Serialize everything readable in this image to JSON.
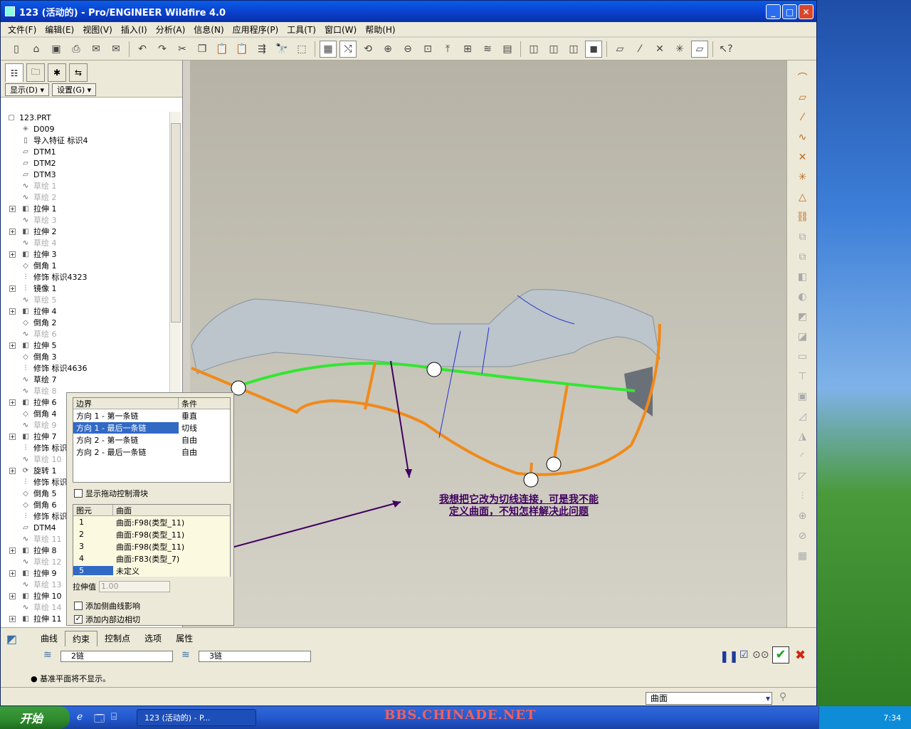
{
  "window": {
    "title": "123 (活动的) - Pro/ENGINEER Wildfire 4.0"
  },
  "menu": [
    "文件(F)",
    "编辑(E)",
    "视图(V)",
    "插入(I)",
    "分析(A)",
    "信息(N)",
    "应用程序(P)",
    "工具(T)",
    "窗口(W)",
    "帮助(H)"
  ],
  "panel": {
    "show_btn": "显示(D) ▾",
    "settings_btn": "设置(G) ▾"
  },
  "tree": [
    {
      "label": "123.PRT",
      "exp": false,
      "grey": false,
      "icon": "part-icon",
      "lvl": 0
    },
    {
      "label": "D009",
      "exp": false,
      "grey": false,
      "icon": "csys-icon",
      "lvl": 1
    },
    {
      "label": "导入特征 标识4",
      "exp": false,
      "grey": false,
      "icon": "import-icon",
      "lvl": 1
    },
    {
      "label": "DTM1",
      "exp": false,
      "grey": false,
      "icon": "datum-plane-icon",
      "lvl": 1
    },
    {
      "label": "DTM2",
      "exp": false,
      "grey": false,
      "icon": "datum-plane-icon",
      "lvl": 1
    },
    {
      "label": "DTM3",
      "exp": false,
      "grey": false,
      "icon": "datum-plane-icon",
      "lvl": 1
    },
    {
      "label": "草绘 1",
      "exp": false,
      "grey": true,
      "icon": "sketch-icon",
      "lvl": 1
    },
    {
      "label": "草绘 2",
      "exp": false,
      "grey": true,
      "icon": "sketch-icon",
      "lvl": 1
    },
    {
      "label": "拉伸 1",
      "exp": true,
      "grey": false,
      "icon": "extrude-icon",
      "lvl": 1
    },
    {
      "label": "草绘 3",
      "exp": false,
      "grey": true,
      "icon": "sketch-icon",
      "lvl": 1
    },
    {
      "label": "拉伸 2",
      "exp": true,
      "grey": false,
      "icon": "extrude-icon",
      "lvl": 1
    },
    {
      "label": "草绘 4",
      "exp": false,
      "grey": true,
      "icon": "sketch-icon",
      "lvl": 1
    },
    {
      "label": "拉伸 3",
      "exp": true,
      "grey": false,
      "icon": "extrude-icon",
      "lvl": 1
    },
    {
      "label": "倒角 1",
      "exp": false,
      "grey": false,
      "icon": "chamfer-icon",
      "lvl": 1
    },
    {
      "label": "修饰 标识4323",
      "exp": false,
      "grey": false,
      "icon": "cosmetic-icon",
      "lvl": 1
    },
    {
      "label": "镜像 1",
      "exp": true,
      "grey": false,
      "icon": "mirror-icon",
      "lvl": 1
    },
    {
      "label": "草绘 5",
      "exp": false,
      "grey": true,
      "icon": "sketch-icon",
      "lvl": 1
    },
    {
      "label": "拉伸 4",
      "exp": true,
      "grey": false,
      "icon": "extrude-icon",
      "lvl": 1
    },
    {
      "label": "倒角 2",
      "exp": false,
      "grey": false,
      "icon": "chamfer-icon",
      "lvl": 1
    },
    {
      "label": "草绘 6",
      "exp": false,
      "grey": true,
      "icon": "sketch-icon",
      "lvl": 1
    },
    {
      "label": "拉伸 5",
      "exp": true,
      "grey": false,
      "icon": "extrude-icon",
      "lvl": 1
    },
    {
      "label": "倒角 3",
      "exp": false,
      "grey": false,
      "icon": "chamfer-icon",
      "lvl": 1
    },
    {
      "label": "修饰 标识4636",
      "exp": false,
      "grey": false,
      "icon": "cosmetic-icon",
      "lvl": 1
    },
    {
      "label": "草绘 7",
      "exp": false,
      "grey": false,
      "icon": "sketch-icon",
      "lvl": 1
    },
    {
      "label": "草绘 8",
      "exp": false,
      "grey": true,
      "icon": "sketch-icon",
      "lvl": 1
    },
    {
      "label": "拉伸 6",
      "exp": true,
      "grey": false,
      "icon": "extrude-icon",
      "lvl": 1
    },
    {
      "label": "倒角 4",
      "exp": false,
      "grey": false,
      "icon": "chamfer-icon",
      "lvl": 1
    },
    {
      "label": "草绘 9",
      "exp": false,
      "grey": true,
      "icon": "sketch-icon",
      "lvl": 1
    },
    {
      "label": "拉伸 7",
      "exp": true,
      "grey": false,
      "icon": "extrude-icon",
      "lvl": 1
    },
    {
      "label": "修饰 标识",
      "exp": false,
      "grey": false,
      "icon": "cosmetic-icon",
      "lvl": 1
    },
    {
      "label": "草绘 10",
      "exp": false,
      "grey": true,
      "icon": "sketch-icon",
      "lvl": 1
    },
    {
      "label": "旋转 1",
      "exp": true,
      "grey": false,
      "icon": "revolve-icon",
      "lvl": 1
    },
    {
      "label": "修饰 标识",
      "exp": false,
      "grey": false,
      "icon": "cosmetic-icon",
      "lvl": 1
    },
    {
      "label": "倒角 5",
      "exp": false,
      "grey": false,
      "icon": "chamfer-icon",
      "lvl": 1
    },
    {
      "label": "倒角 6",
      "exp": false,
      "grey": false,
      "icon": "chamfer-icon",
      "lvl": 1
    },
    {
      "label": "修饰 标识",
      "exp": false,
      "grey": false,
      "icon": "cosmetic-icon",
      "lvl": 1
    },
    {
      "label": "DTM4",
      "exp": false,
      "grey": false,
      "icon": "datum-plane-icon",
      "lvl": 1
    },
    {
      "label": "草绘 11",
      "exp": false,
      "grey": true,
      "icon": "sketch-icon",
      "lvl": 1
    },
    {
      "label": "拉伸 8",
      "exp": true,
      "grey": false,
      "icon": "extrude-icon",
      "lvl": 1
    },
    {
      "label": "草绘 12",
      "exp": false,
      "grey": true,
      "icon": "sketch-icon",
      "lvl": 1
    },
    {
      "label": "拉伸 9",
      "exp": true,
      "grey": false,
      "icon": "extrude-icon",
      "lvl": 1
    },
    {
      "label": "草绘 13",
      "exp": false,
      "grey": true,
      "icon": "sketch-icon",
      "lvl": 1
    },
    {
      "label": "拉伸 10",
      "exp": true,
      "grey": false,
      "icon": "extrude-icon",
      "lvl": 1
    },
    {
      "label": "草绘 14",
      "exp": false,
      "grey": true,
      "icon": "sketch-icon",
      "lvl": 1
    },
    {
      "label": "拉伸 11",
      "exp": true,
      "grey": false,
      "icon": "extrude-icon",
      "lvl": 1
    }
  ],
  "constraints": {
    "headers": [
      "边界",
      "条件"
    ],
    "rows": [
      {
        "b": "方向 1 - 第一条链",
        "c": "垂直"
      },
      {
        "b": "方向 1 - 最后一条链",
        "c": "切线"
      },
      {
        "b": "方向 2 - 第一条链",
        "c": "自由"
      },
      {
        "b": "方向 2 - 最后一条链",
        "c": "自由"
      }
    ],
    "selected_row": 1,
    "show_handles": "显示拖动控制滑块",
    "ref_headers": [
      "图元",
      "曲面"
    ],
    "refs": [
      {
        "n": "1",
        "s": "曲面:F98(类型_11)"
      },
      {
        "n": "2",
        "s": "曲面:F98(类型_11)"
      },
      {
        "n": "3",
        "s": "曲面:F98(类型_11)"
      },
      {
        "n": "4",
        "s": "曲面:F83(类型_7)"
      },
      {
        "n": "5",
        "s": "未定义"
      }
    ],
    "selected_ref": 4,
    "stretch_label": "拉伸值",
    "stretch_value": "1.00",
    "add_side": "添加侧曲线影响",
    "add_inner": "添加内部边相切",
    "add_side_checked": false,
    "add_inner_checked": true
  },
  "annotation": {
    "line1": "我想把它改为切线连接，可是我不能",
    "line2": "定义曲面，不知怎样解决此问题"
  },
  "dashboard": {
    "tabs": [
      "曲线",
      "约束",
      "控制点",
      "选项",
      "属性"
    ],
    "active_tab": 1,
    "chain1": "2链",
    "chain2": "3链"
  },
  "message": "● 基准平面将不显示。",
  "status": {
    "filter": "曲面"
  },
  "taskbar": {
    "start": "开始",
    "task": "123 (活动的) - P...",
    "clock": "7:34"
  },
  "watermark": "BBS.CHINADE.NET",
  "colors": {
    "chain_green": "#33e633",
    "edge_orange": "#f08a1a",
    "annot_purple": "#400060"
  }
}
